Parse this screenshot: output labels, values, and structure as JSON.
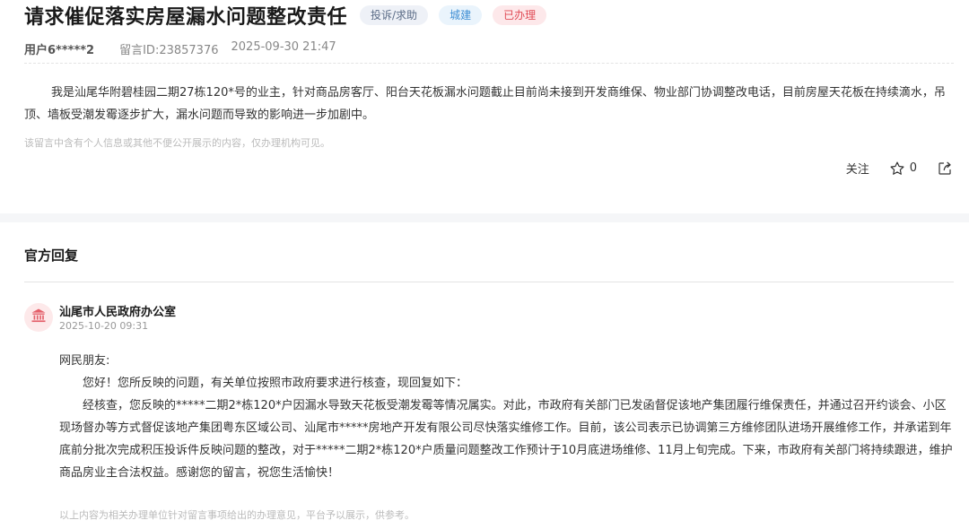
{
  "message": {
    "title": "请求催促落实房屋漏水问题整改责任",
    "tags": {
      "type": "投诉/求助",
      "department": "城建",
      "status": "已办理"
    },
    "user": "用户6*****2",
    "message_id": "留言ID:23857376",
    "time": "2025-09-30 21:47",
    "content": "我是汕尾华附碧桂园二期27栋120*号的业主，针对商品房客厅、阳台天花板漏水问题截止目前尚未接到开发商维保、物业部门协调整改电话，目前房屋天花板在持续滴水，吊顶、墙板受潮发霉逐步扩大，漏水问题而导致的影响进一步加剧中。",
    "privacy_note": "该留言中含有个人信息或其他不便公开展示的内容，仅办理机构可见。"
  },
  "actions": {
    "follow_label": "关注",
    "like_count": "0",
    "icons": {
      "like": "star-icon",
      "share": "share-icon"
    }
  },
  "reply": {
    "section_title": "官方回复",
    "org_name": "汕尾市人民政府办公室",
    "org_icon": "government-building-icon",
    "time": "2025-10-20 09:31",
    "greeting": "网民朋友:",
    "line1": "您好！您所反映的问题，有关单位按照市政府要求进行核查，现回复如下：",
    "line2": "经核查，您反映的*****二期2*栋120*户因漏水导致天花板受潮发霉等情况属实。对此，市政府有关部门已发函督促该地产集团履行维保责任，并通过召开约谈会、小区现场督办等方式督促该地产集团粤东区域公司、汕尾市*****房地产开发有限公司尽快落实维修工作。目前，该公司表示已协调第三方维修团队进场开展维修工作，并承诺到年底前分批次完成积压投诉件反映问题的整改，对于*****二期2*栋120*户质量问题整改工作预计于10月底进场维修、11月上旬完成。下来，市政府有关部门将持续跟进，维护商品房业主合法权益。感谢您的留言，祝您生活愉快！",
    "footnote": "以上内容为相关办理单位针对留言事项给出的办理意见，平台予以展示，供参考。"
  },
  "colors": {
    "status_red": "#e04b55",
    "dept_blue": "#3e8ed4",
    "type_gray": "#5a6b86",
    "avatar_bg": "#fde9ea",
    "avatar_icon": "#e4606a"
  }
}
